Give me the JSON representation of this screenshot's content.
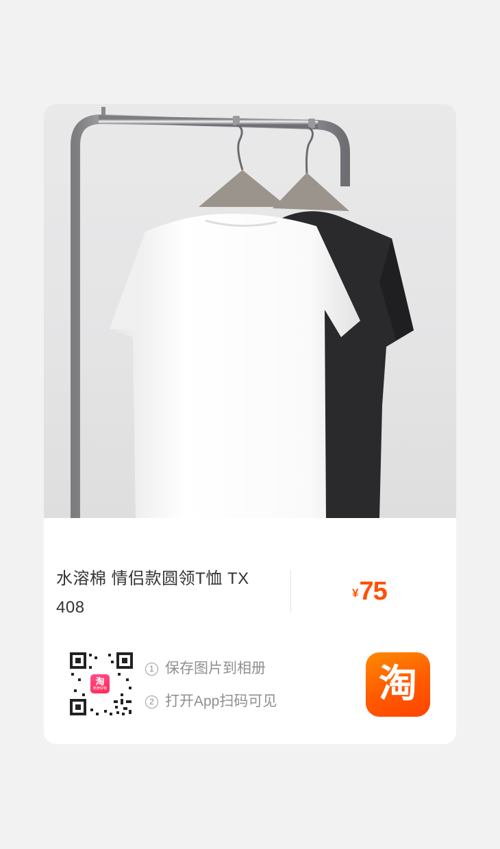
{
  "product": {
    "title": "水溶棉 情侣款圆领T恤 TX 408",
    "price_currency": "¥",
    "price_value": "75",
    "image": "white-and-black-tshirts-on-rack"
  },
  "share": {
    "step1_num": "1",
    "step1_label": "保存图片到相册",
    "step2_num": "2",
    "step2_label": "打开App扫码可见",
    "mini_logo_char": "淘",
    "mini_logo_sub": "新奇好物",
    "taobao_logo_char": "淘"
  },
  "colors": {
    "price": "#ff5000",
    "taobao_orange": "#ff5a00",
    "mini_logo_pink": "#ff2a55"
  }
}
